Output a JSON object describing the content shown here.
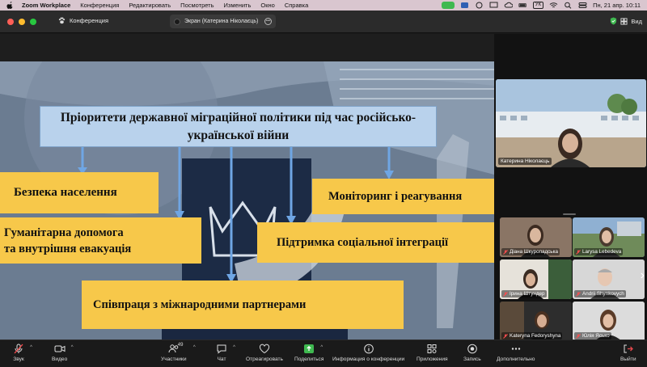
{
  "menubar": {
    "app": "Zoom Workplace",
    "items": [
      "Конференция",
      "Редактировать",
      "Посмотреть",
      "Изменить",
      "Окно",
      "Справка"
    ],
    "input_lang": "УК",
    "clock": "Пн, 21 апр.  10:11"
  },
  "titlebar": {
    "conference_label": "Конференция",
    "share_label": "Экран (Катерина Ніколаєць)",
    "view_label": "Вид"
  },
  "slide": {
    "title": "Пріоритети державної міграційної політики під час російсько-української війни",
    "box1": "Безпека населення",
    "box2_line1": "Гуманітарна допомога",
    "box2_line2": "та внутрішня евакуація",
    "box3": "Моніторинг і реагування",
    "box4": "Підтримка соціальної інтеграції",
    "box5": "Співпраця з міжнародними партнерами"
  },
  "participants": {
    "active_speaker": "Катерина Ніколаєць",
    "grid": [
      {
        "name": "Діана Шкуропадська",
        "muted": true
      },
      {
        "name": "Larysa Lebedeva",
        "muted": true
      },
      {
        "name": "Ірина Штундер",
        "muted": true
      },
      {
        "name": "Andrii Shynkovych",
        "muted": true
      },
      {
        "name": "Kateryna Fedoryshyna",
        "muted": true
      },
      {
        "name": "Юлія Ясько",
        "muted": true
      }
    ]
  },
  "toolbar": {
    "audio": "Звук",
    "video": "Видео",
    "participants": "Участники",
    "participants_count": "49",
    "chat": "Чат",
    "react": "Отреагировать",
    "share": "Поделиться",
    "info": "Информация о конференции",
    "apps": "Приложения",
    "record": "Запись",
    "more": "Дополнительно",
    "leave": "Выйти"
  },
  "colors": {
    "accent_green": "#3fb950",
    "slide_box": "#f7c84a",
    "title_box": "#b9d2ec",
    "leave_red": "#e5484d"
  }
}
